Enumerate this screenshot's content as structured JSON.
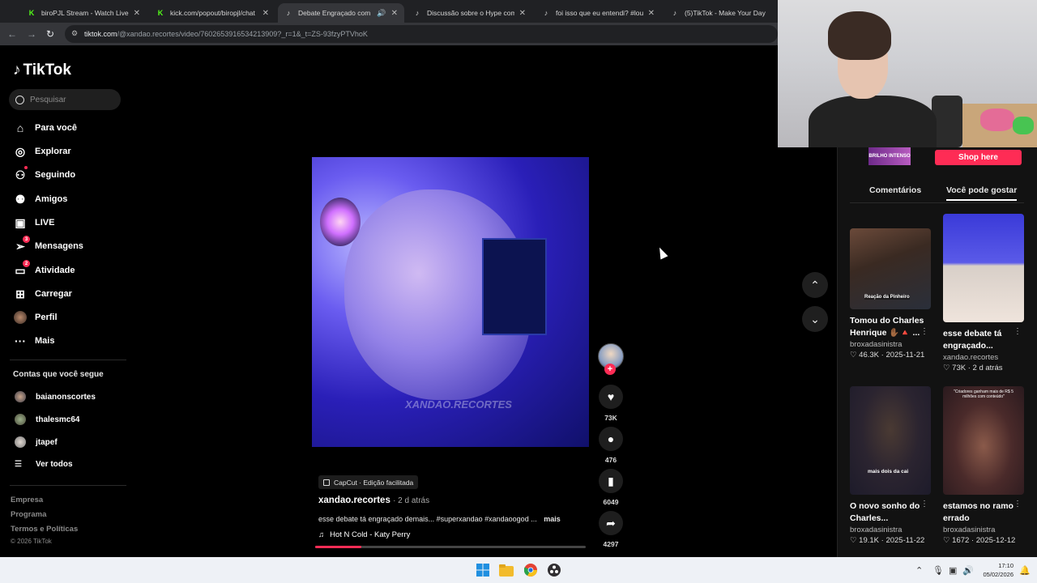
{
  "browser": {
    "tabs": [
      {
        "title": "biroPJL Stream - Watch Live on",
        "favicon": "K",
        "favicon_color": "#53fc18"
      },
      {
        "title": "kick.com/popout/biropjl/chat",
        "favicon": "K",
        "favicon_color": "#53fc18"
      },
      {
        "title": "Debate Engraçado com Su",
        "favicon": "tiktok-icon",
        "favicon_color": "#ffffff",
        "audio": true,
        "active": true
      },
      {
        "title": "Discussão sobre o Hype com Lu",
        "favicon": "tiktok-icon",
        "favicon_color": "#ffffff"
      },
      {
        "title": "foi isso que eu entendi? #loudc",
        "favicon": "tiktok-icon",
        "favicon_color": "#ffffff"
      },
      {
        "title": "(5)TikTok - Make Your Day",
        "favicon": "tiktok-icon",
        "favicon_color": "#ffffff"
      }
    ],
    "url_host": "tiktok.com",
    "url_path": "/@xandao.recortes/video/7602653916534213909?_r=1&_t=ZS-93fzyPTVhoK"
  },
  "sidebar": {
    "logo": "TikTok",
    "search_placeholder": "Pesquisar",
    "nav": [
      {
        "label": "Para você",
        "icon": "home-icon"
      },
      {
        "label": "Explorar",
        "icon": "compass-icon"
      },
      {
        "label": "Seguindo",
        "icon": "following-icon"
      },
      {
        "label": "Amigos",
        "icon": "friends-icon"
      },
      {
        "label": "LIVE",
        "icon": "live-icon"
      },
      {
        "label": "Mensagens",
        "icon": "send-icon",
        "badge": "3"
      },
      {
        "label": "Atividade",
        "icon": "inbox-icon",
        "badge": "2"
      },
      {
        "label": "Carregar",
        "icon": "upload-icon"
      },
      {
        "label": "Perfil",
        "icon": "profile-avatar"
      },
      {
        "label": "Mais",
        "icon": "more-icon"
      }
    ],
    "following_title": "Contas que você segue",
    "following": [
      "baianonscortes",
      "thalesmc64",
      "jtapef"
    ],
    "see_all": "Ver todos",
    "footer": [
      "Empresa",
      "Programa",
      "Termos e Políticas"
    ],
    "copyright": "© 2026 TikTok"
  },
  "video": {
    "watermark": "XANDAO.RECORTES",
    "capcut_label": "CapCut · Edição facilitada",
    "author": "xandao.recortes",
    "posted": "· 2 d atrás",
    "description": "esse debate tá engraçado demais... #superxandao #xandaoogod ...",
    "more_label": "mais",
    "music": "Hot N Cold - Katy Perry",
    "progress": 0.17,
    "likes": "73K",
    "comments": "476",
    "saves": "6049",
    "shares": "4297"
  },
  "right_panel": {
    "shop_thumb_text": "BRILHO INTENSO",
    "shop_button": "Shop here",
    "tabs": [
      "Comentários",
      "Você pode gostar"
    ],
    "active_tab": 1,
    "cards": [
      {
        "title": "Tomou do Charles Henrique ✋🏾🔺 ...",
        "author": "broxadasinistra",
        "likes": "46.3K",
        "date": "2025-11-21",
        "caption": "Reação da Pinheiro"
      },
      {
        "title": "esse debate tá engraçado...",
        "author": "xandao.recortes",
        "likes": "73K",
        "date": "2 d atrás",
        "caption": ""
      },
      {
        "title": "O novo sonho do Charles...",
        "author": "broxadasinistra",
        "likes": "19.1K",
        "date": "2025-11-22",
        "caption": "mais dois da cai"
      },
      {
        "title": "estamos no ramo errado",
        "author": "broxadasinistra",
        "likes": "1672",
        "date": "2025-12-12",
        "caption": "\"Criadores ganham mais de R$ 5 milhões com conteúdo\""
      }
    ]
  },
  "taskbar": {
    "time": "17:10",
    "date": "05/02/2026"
  }
}
